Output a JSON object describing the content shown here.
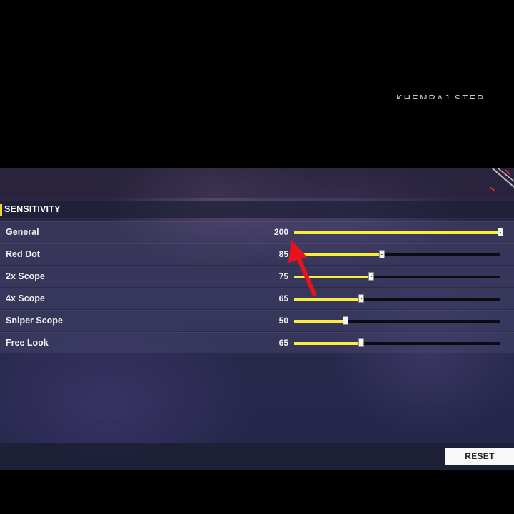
{
  "watermark": "KHEMRAJ STER",
  "section": {
    "title": "SENSITIVITY"
  },
  "slider_max": 200,
  "rows": [
    {
      "label": "General",
      "value": "200",
      "level": 200
    },
    {
      "label": "Red Dot",
      "value": "85",
      "level": 85
    },
    {
      "label": "2x Scope",
      "value": "75",
      "level": 75
    },
    {
      "label": "4x Scope",
      "value": "65",
      "level": 65
    },
    {
      "label": "Sniper Scope",
      "value": "50",
      "level": 50
    },
    {
      "label": "Free Look",
      "value": "65",
      "level": 65
    }
  ],
  "footer": {
    "reset_label": "RESET"
  },
  "colors": {
    "accent": "#f2d72a",
    "fill": "#f7f03a",
    "arrow": "#e8121c"
  }
}
